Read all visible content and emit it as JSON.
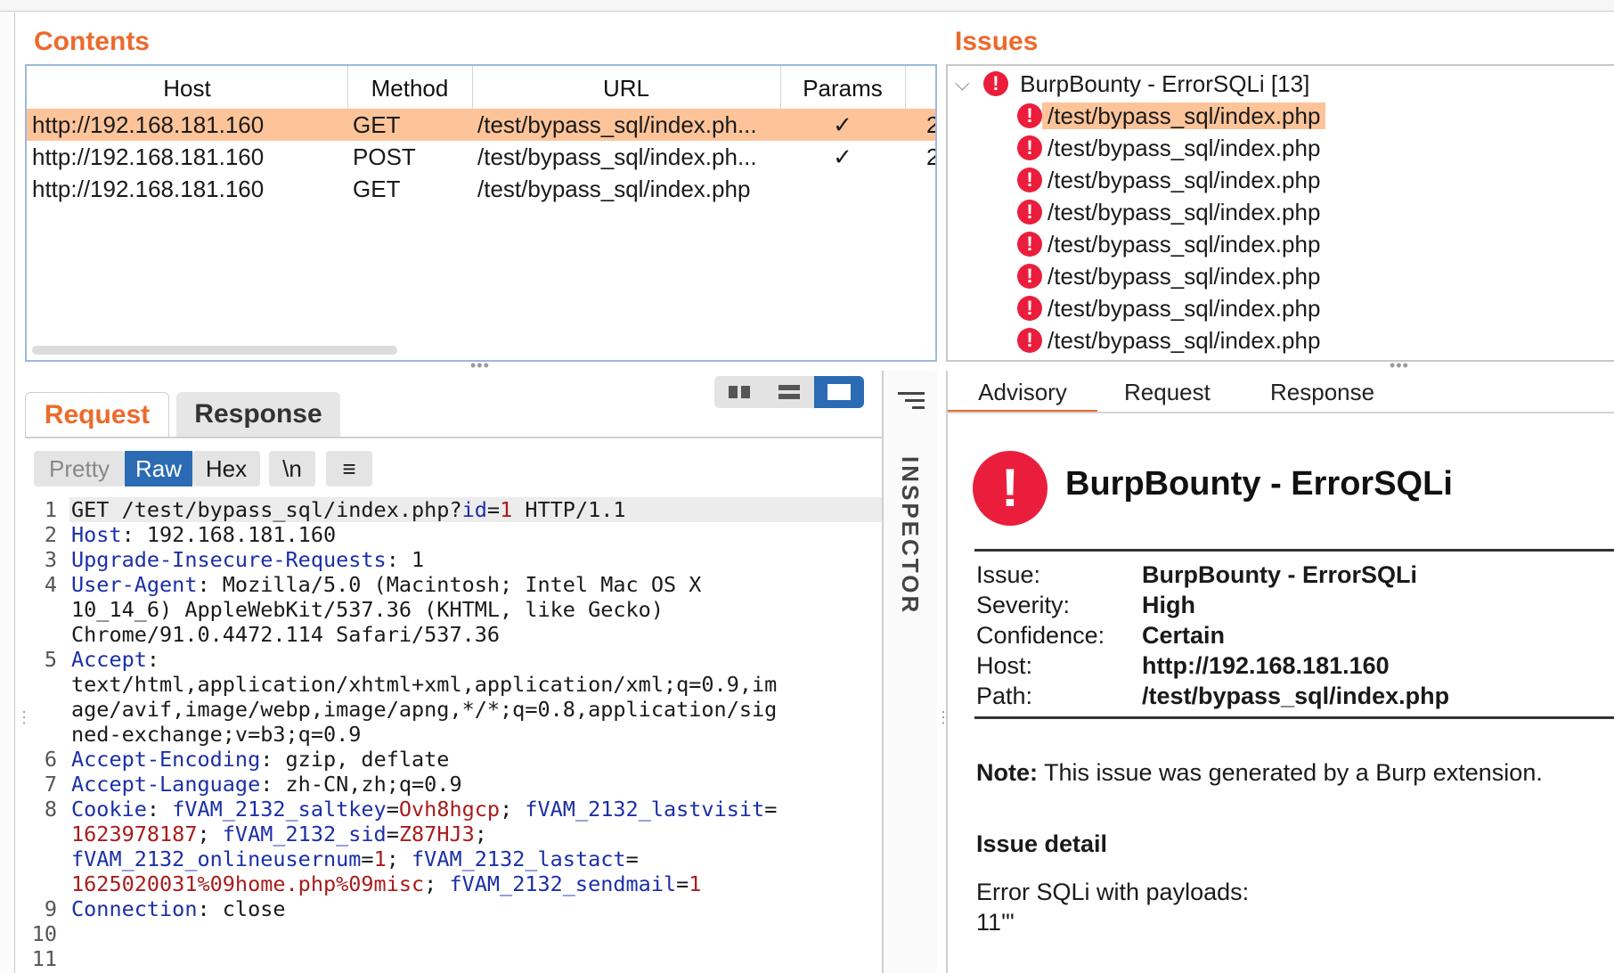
{
  "contents": {
    "title": "Contents",
    "columns": [
      "Host",
      "Method",
      "URL",
      "Params"
    ],
    "rows": [
      {
        "host": "http://192.168.181.160",
        "method": "GET",
        "url": "/test/bypass_sql/index.ph...",
        "params": "✓",
        "extra": "2"
      },
      {
        "host": "http://192.168.181.160",
        "method": "POST",
        "url": "/test/bypass_sql/index.ph...",
        "params": "✓",
        "extra": "2"
      },
      {
        "host": "http://192.168.181.160",
        "method": "GET",
        "url": "/test/bypass_sql/index.php",
        "params": "",
        "extra": ""
      }
    ]
  },
  "issues": {
    "title": "Issues",
    "group_label": "BurpBounty - ErrorSQLi [13]",
    "items": [
      "/test/bypass_sql/index.php",
      "/test/bypass_sql/index.php",
      "/test/bypass_sql/index.php",
      "/test/bypass_sql/index.php",
      "/test/bypass_sql/index.php",
      "/test/bypass_sql/index.php",
      "/test/bypass_sql/index.php",
      "/test/bypass_sql/index.php"
    ]
  },
  "request_panel": {
    "tabs": [
      "Request",
      "Response"
    ],
    "format_buttons": [
      "Pretty",
      "Raw",
      "Hex",
      "\\n",
      "≡"
    ],
    "inspector_label": "INSPECTOR",
    "lines": [
      {
        "n": "1",
        "parts": [
          [
            "p",
            "GET /test/bypass_sql/index.php?"
          ],
          [
            "k",
            "id"
          ],
          [
            "p",
            "="
          ],
          [
            "v",
            "1"
          ],
          [
            "p",
            " HTTP/1.1"
          ]
        ]
      },
      {
        "n": "2",
        "parts": [
          [
            "k",
            "Host"
          ],
          [
            "p",
            ": 192.168.181.160"
          ]
        ]
      },
      {
        "n": "3",
        "parts": [
          [
            "k",
            "Upgrade-Insecure-Requests"
          ],
          [
            "p",
            ": 1"
          ]
        ]
      },
      {
        "n": "4",
        "parts": [
          [
            "k",
            "User-Agent"
          ],
          [
            "p",
            ": Mozilla/5.0 (Macintosh; Intel Mac OS X"
          ]
        ]
      },
      {
        "n": "",
        "parts": [
          [
            "p",
            "10_14_6) AppleWebKit/537.36 (KHTML, like Gecko)"
          ]
        ]
      },
      {
        "n": "",
        "parts": [
          [
            "p",
            "Chrome/91.0.4472.114 Safari/537.36"
          ]
        ]
      },
      {
        "n": "5",
        "parts": [
          [
            "k",
            "Accept"
          ],
          [
            "p",
            ":"
          ]
        ]
      },
      {
        "n": "",
        "parts": [
          [
            "p",
            "text/html,application/xhtml+xml,application/xml;q=0.9,im"
          ]
        ]
      },
      {
        "n": "",
        "parts": [
          [
            "p",
            "age/avif,image/webp,image/apng,*/*;q=0.8,application/sig"
          ]
        ]
      },
      {
        "n": "",
        "parts": [
          [
            "p",
            "ned-exchange;v=b3;q=0.9"
          ]
        ]
      },
      {
        "n": "6",
        "parts": [
          [
            "k",
            "Accept-Encoding"
          ],
          [
            "p",
            ": gzip, deflate"
          ]
        ]
      },
      {
        "n": "7",
        "parts": [
          [
            "k",
            "Accept-Language"
          ],
          [
            "p",
            ": zh-CN,zh;q=0.9"
          ]
        ]
      },
      {
        "n": "8",
        "parts": [
          [
            "k",
            "Cookie"
          ],
          [
            "p",
            ": "
          ],
          [
            "k",
            "fVAM_2132_saltkey"
          ],
          [
            "p",
            "="
          ],
          [
            "v",
            "Ovh8hgcp"
          ],
          [
            "p",
            "; "
          ],
          [
            "k",
            "fVAM_2132_lastvisit"
          ],
          [
            "p",
            "="
          ]
        ]
      },
      {
        "n": "",
        "parts": [
          [
            "v",
            "1623978187"
          ],
          [
            "p",
            "; "
          ],
          [
            "k",
            "fVAM_2132_sid"
          ],
          [
            "p",
            "="
          ],
          [
            "v",
            "Z87HJ3"
          ],
          [
            "p",
            ";"
          ]
        ]
      },
      {
        "n": "",
        "parts": [
          [
            "k",
            "fVAM_2132_onlineusernum"
          ],
          [
            "p",
            "="
          ],
          [
            "v",
            "1"
          ],
          [
            "p",
            "; "
          ],
          [
            "k",
            "fVAM_2132_lastact"
          ],
          [
            "p",
            "="
          ]
        ]
      },
      {
        "n": "",
        "parts": [
          [
            "v",
            "1625020031%09home.php%09misc"
          ],
          [
            "p",
            "; "
          ],
          [
            "k",
            "fVAM_2132_sendmail"
          ],
          [
            "p",
            "="
          ],
          [
            "v",
            "1"
          ]
        ]
      },
      {
        "n": "9",
        "parts": [
          [
            "k",
            "Connection"
          ],
          [
            "p",
            ": close"
          ]
        ]
      },
      {
        "n": "10",
        "parts": []
      },
      {
        "n": "11",
        "parts": []
      }
    ]
  },
  "advisory": {
    "tabs": [
      "Advisory",
      "Request",
      "Response"
    ],
    "title": "BurpBounty - ErrorSQLi",
    "fields": [
      {
        "label": "Issue:",
        "value": "BurpBounty - ErrorSQLi"
      },
      {
        "label": "Severity:",
        "value": "High"
      },
      {
        "label": "Confidence:",
        "value": "Certain"
      },
      {
        "label": "Host:",
        "value": "http://192.168.181.160"
      },
      {
        "label": "Path:",
        "value": "/test/bypass_sql/index.php"
      }
    ],
    "note_label": "Note:",
    "note_text": "This issue was generated by a Burp extension.",
    "detail_heading": "Issue detail",
    "detail_text": "Error SQLi with payloads:",
    "payload": "11'\""
  },
  "colors": {
    "accent": "#ec6a2c",
    "selection": "#fdc49a",
    "severity_high": "#ea1e3c",
    "button_active": "#2a6bb3"
  }
}
